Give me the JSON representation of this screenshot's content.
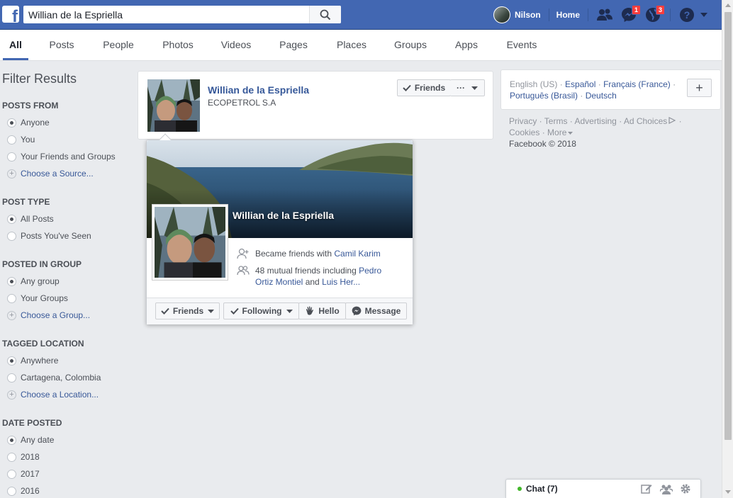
{
  "topbar": {
    "logo_letter": "f",
    "search": {
      "value": "Willian de la Espriella",
      "placeholder": "Search"
    },
    "user_name": "Nilson",
    "home_label": "Home",
    "messages_badge": "1",
    "notifications_badge": "3",
    "brand_color": "#4267b2"
  },
  "tabs": [
    {
      "label": "All",
      "active": true
    },
    {
      "label": "Posts"
    },
    {
      "label": "People"
    },
    {
      "label": "Photos"
    },
    {
      "label": "Videos"
    },
    {
      "label": "Pages"
    },
    {
      "label": "Places"
    },
    {
      "label": "Groups"
    },
    {
      "label": "Apps"
    },
    {
      "label": "Events"
    }
  ],
  "filters": {
    "title": "Filter Results",
    "posts_from": {
      "heading": "POSTS FROM",
      "options": [
        "Anyone",
        "You",
        "Your Friends and Groups"
      ],
      "choose": "Choose a Source..."
    },
    "post_type": {
      "heading": "POST TYPE",
      "options": [
        "All Posts",
        "Posts You've Seen"
      ]
    },
    "posted_in_group": {
      "heading": "POSTED IN GROUP",
      "options": [
        "Any group",
        "Your Groups"
      ],
      "choose": "Choose a Group..."
    },
    "tagged_location": {
      "heading": "TAGGED LOCATION",
      "options": [
        "Anywhere",
        "Cartagena, Colombia"
      ],
      "choose": "Choose a Location..."
    },
    "date_posted": {
      "heading": "DATE POSTED",
      "options": [
        "Any date",
        "2018",
        "2017",
        "2016"
      ]
    }
  },
  "result": {
    "name": "Willian de la Espriella",
    "subtitle": "ECOPETROL S.A",
    "friends_button": "Friends",
    "more_button": "···"
  },
  "hovercard": {
    "name": "Willian de la Espriella",
    "became_friends_prefix": "Became friends with ",
    "became_friends_link": "Camil Karim",
    "mutual_prefix": "48 mutual friends including ",
    "mutual_link1": "Pedro Ortiz Montiel",
    "mutual_and": " and ",
    "mutual_link2": "Luis Her...",
    "buttons": {
      "friends": "Friends",
      "following": "Following",
      "hello": "Hello",
      "message": "Message"
    }
  },
  "languages": {
    "current": "English (US)",
    "others": [
      "Español",
      "Français (France)",
      "Português (Brasil)",
      "Deutsch"
    ],
    "add_label": "+"
  },
  "footer": {
    "links": [
      "Privacy",
      "Terms",
      "Advertising",
      "Ad Choices",
      "Cookies",
      "More"
    ],
    "copyright": "Facebook © 2018"
  },
  "chat": {
    "label": "Chat (7)",
    "online_color": "#42b72a"
  }
}
